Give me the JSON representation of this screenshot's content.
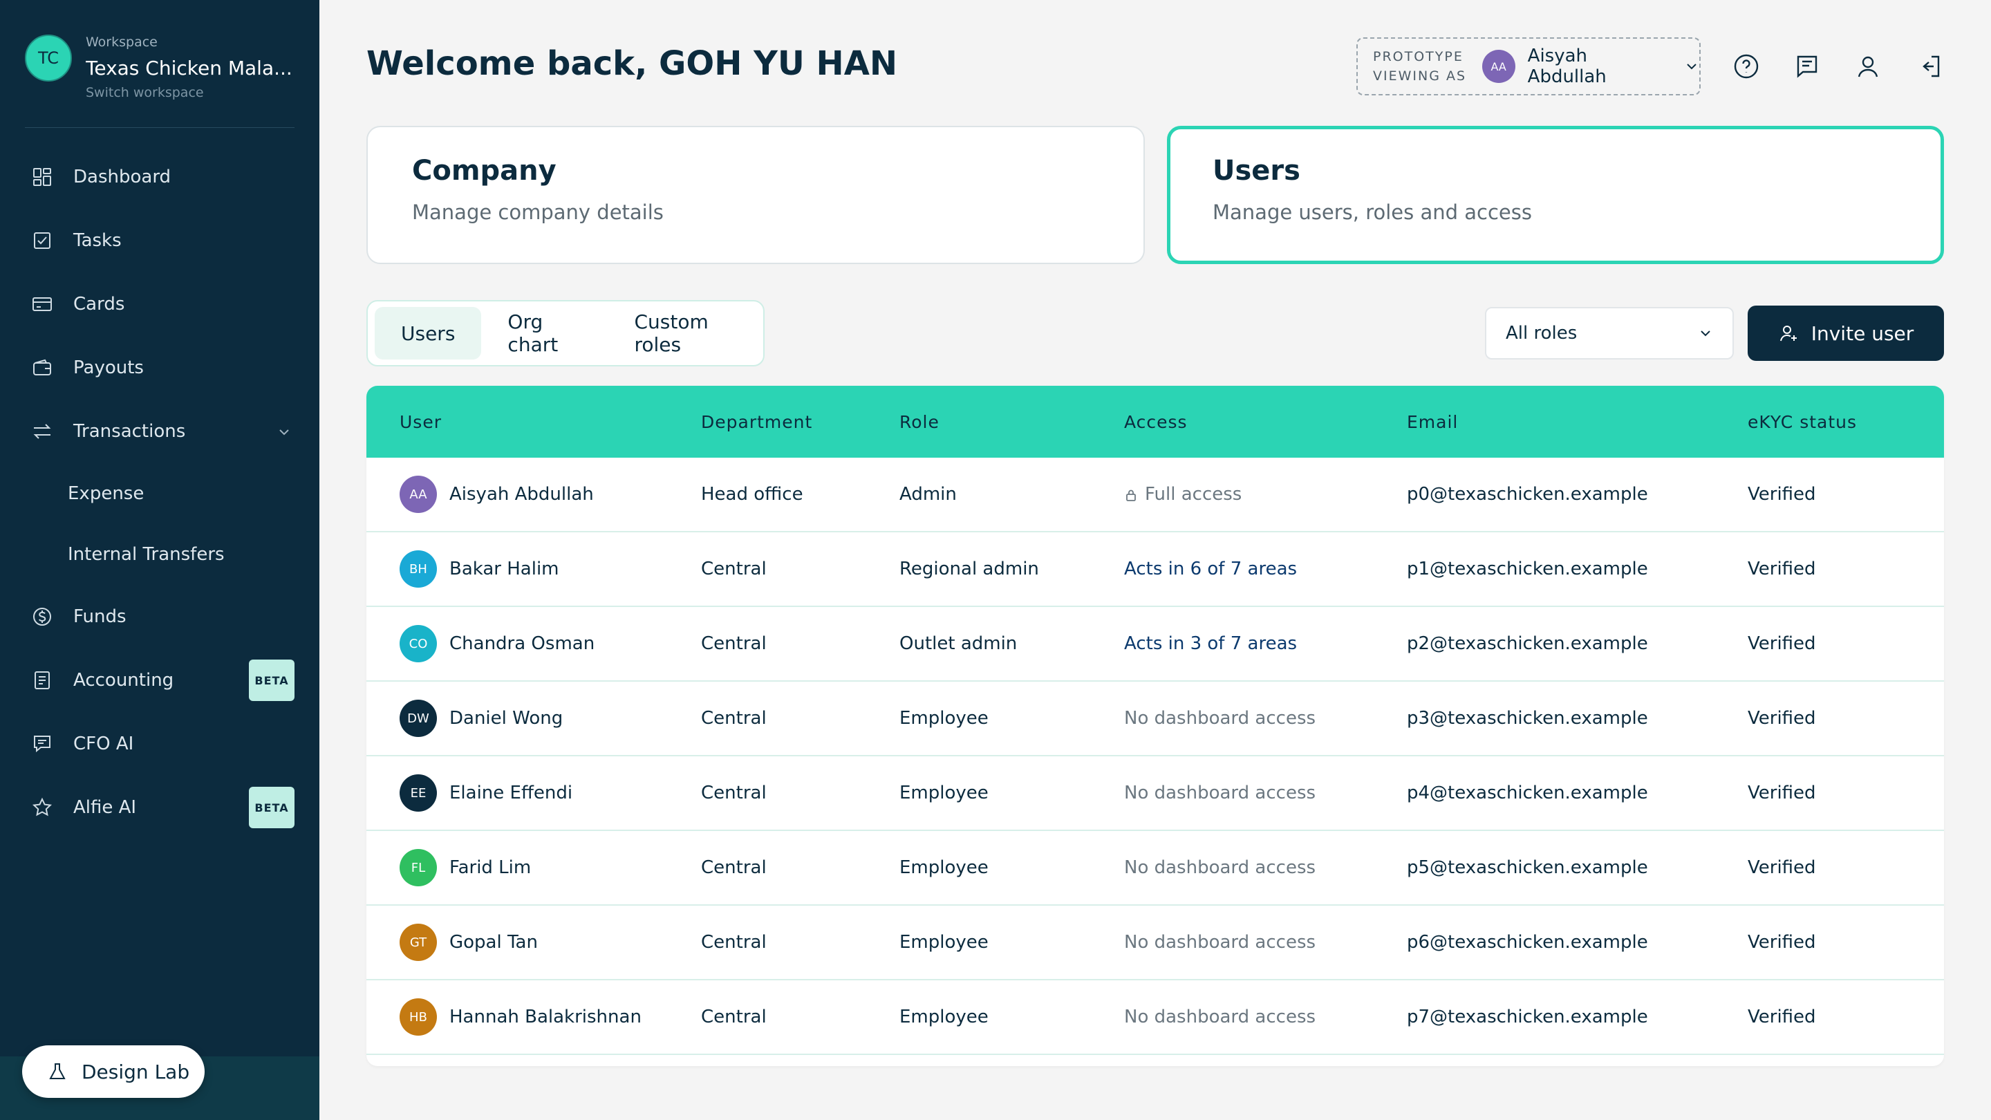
{
  "workspace": {
    "label": "Workspace",
    "initials": "TC",
    "name": "Texas Chicken Mala...",
    "switch_label": "Switch workspace"
  },
  "nav": [
    {
      "label": "Dashboard",
      "icon": "dashboard-icon"
    },
    {
      "label": "Tasks",
      "icon": "tasks-icon"
    },
    {
      "label": "Cards",
      "icon": "card-icon"
    },
    {
      "label": "Payouts",
      "icon": "wallet-icon"
    },
    {
      "label": "Transactions",
      "icon": "transfer-icon",
      "expanded": true
    },
    {
      "label": "Expense",
      "sub": true
    },
    {
      "label": "Internal Transfers",
      "sub": true
    },
    {
      "label": "Funds",
      "icon": "dollar-icon"
    },
    {
      "label": "Accounting",
      "icon": "ledger-icon",
      "badge": "BETA"
    },
    {
      "label": "CFO AI",
      "icon": "chat-icon"
    },
    {
      "label": "Alfie AI",
      "icon": "star-icon",
      "badge": "BETA"
    }
  ],
  "design_lab": {
    "label": "Design Lab",
    "icon": "flask-icon"
  },
  "header": {
    "welcome": "Welcome back, GOH YU HAN",
    "prototype_line1": "PROTOTYPE",
    "prototype_line2": "VIEWING AS",
    "viewing_initials": "AA",
    "viewing_name": "Aisyah Abdullah",
    "icons": [
      "help-icon",
      "feedback-icon",
      "profile-icon",
      "logout-icon"
    ]
  },
  "cards": [
    {
      "title": "Company",
      "subtitle": "Manage company details",
      "active": false
    },
    {
      "title": "Users",
      "subtitle": "Manage users, roles and access",
      "active": true
    }
  ],
  "tabs": [
    {
      "label": "Users",
      "active": true
    },
    {
      "label": "Org chart",
      "active": false
    },
    {
      "label": "Custom roles",
      "active": false
    }
  ],
  "roles_filter": {
    "value": "All roles"
  },
  "invite_button": {
    "label": "Invite user"
  },
  "table": {
    "columns": [
      "User",
      "Department",
      "Role",
      "Access",
      "Email",
      "eKYC status"
    ],
    "rows": [
      {
        "initials": "AA",
        "color": "#7d66b5",
        "name": "Aisyah Abdullah",
        "department": "Head office",
        "role": "Admin",
        "access": "Full access",
        "access_type": "full",
        "email": "p0@texaschicken.example",
        "ekyc": "Verified"
      },
      {
        "initials": "BH",
        "color": "#1aa9d6",
        "name": "Bakar Halim",
        "department": "Central",
        "role": "Regional admin",
        "access": "Acts in 6 of 7 areas",
        "access_type": "link",
        "email": "p1@texaschicken.example",
        "ekyc": "Verified"
      },
      {
        "initials": "CO",
        "color": "#19b3c9",
        "name": "Chandra Osman",
        "department": "Central",
        "role": "Outlet admin",
        "access": "Acts in 3 of 7 areas",
        "access_type": "link",
        "email": "p2@texaschicken.example",
        "ekyc": "Verified"
      },
      {
        "initials": "DW",
        "color": "#0c2b3e",
        "name": "Daniel Wong",
        "department": "Central",
        "role": "Employee",
        "access": "No dashboard access",
        "access_type": "none",
        "email": "p3@texaschicken.example",
        "ekyc": "Verified"
      },
      {
        "initials": "EE",
        "color": "#0c2b3e",
        "name": "Elaine Effendi",
        "department": "Central",
        "role": "Employee",
        "access": "No dashboard access",
        "access_type": "none",
        "email": "p4@texaschicken.example",
        "ekyc": "Verified"
      },
      {
        "initials": "FL",
        "color": "#2fbf60",
        "name": "Farid Lim",
        "department": "Central",
        "role": "Employee",
        "access": "No dashboard access",
        "access_type": "none",
        "email": "p5@texaschicken.example",
        "ekyc": "Verified"
      },
      {
        "initials": "GT",
        "color": "#c47a12",
        "name": "Gopal Tan",
        "department": "Central",
        "role": "Employee",
        "access": "No dashboard access",
        "access_type": "none",
        "email": "p6@texaschicken.example",
        "ekyc": "Verified"
      },
      {
        "initials": "HB",
        "color": "#c47a12",
        "name": "Hannah Balakrishnan",
        "department": "Central",
        "role": "Employee",
        "access": "No dashboard access",
        "access_type": "none",
        "email": "p7@texaschicken.example",
        "ekyc": "Verified"
      }
    ]
  }
}
